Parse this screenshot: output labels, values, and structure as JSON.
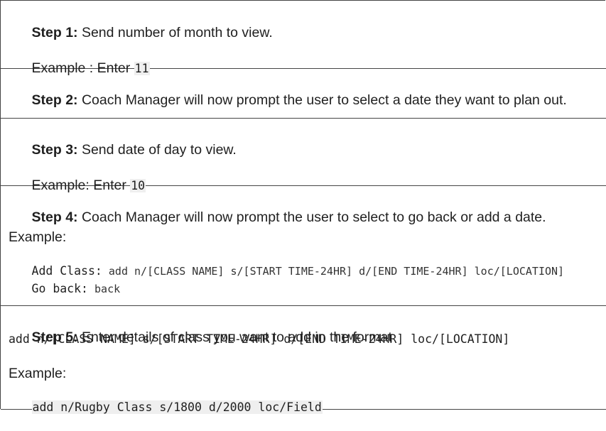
{
  "steps": [
    {
      "label": "Step 1:",
      "text": " Send number of month to view.",
      "example_prefix": "Example : Enter ",
      "example_code": "11"
    },
    {
      "label": "Step 2:",
      "text": " Coach Manager will now prompt the user to select a date they want to plan out."
    },
    {
      "label": "Step 3:",
      "text": " Send date of day to view.",
      "example_prefix": "Example: Enter ",
      "example_code": "10"
    },
    {
      "label": "Step 4:",
      "text": " Coach Manager will now prompt the user to select to go back or add a date.",
      "example_label": "Example:",
      "cmd1_key": "Add Class:",
      "cmd1_val": " add n/[CLASS NAME] s/[START TIME-24HR] d/[END TIME-24HR] loc/[LOCATION]",
      "cmd2_key": "Go back:",
      "cmd2_val": " back"
    },
    {
      "label": "Step 5:",
      "text": " Enter details of class you want to add in the format",
      "format": "add n/[CLASS NAME] s/[START TIME-24HR] d/[END TIME-24HR] loc/[LOCATION]",
      "example_label": "Example:",
      "example_code": "add n/Rugby Class s/1800 d/2000 loc/Field"
    }
  ]
}
